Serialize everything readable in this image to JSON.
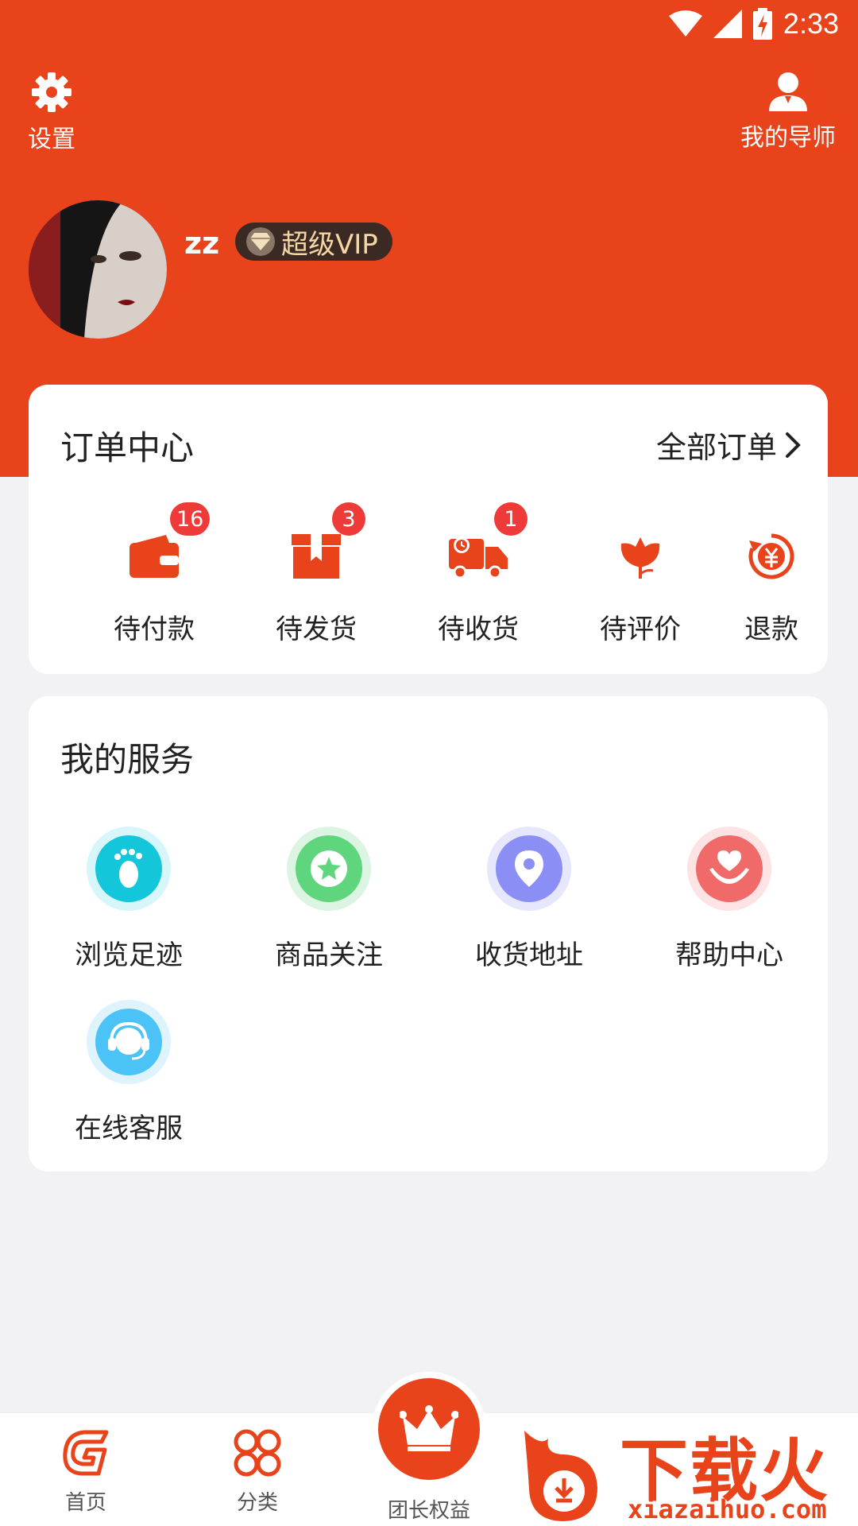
{
  "status_bar": {
    "time": "2:33"
  },
  "header": {
    "settings_label": "设置",
    "mentor_label": "我的导师"
  },
  "profile": {
    "username": "zz",
    "vip_label": "超级VIP"
  },
  "orders": {
    "title": "订单中心",
    "all_orders_label": "全部订单",
    "items": [
      {
        "label": "待付款",
        "badge": "16",
        "icon": "wallet-icon"
      },
      {
        "label": "待发货",
        "badge": "3",
        "icon": "box-icon"
      },
      {
        "label": "待收货",
        "badge": "1",
        "icon": "truck-icon"
      },
      {
        "label": "待评价",
        "badge": "",
        "icon": "flower-icon"
      },
      {
        "label": "退款",
        "badge": "",
        "icon": "refund-icon"
      }
    ]
  },
  "services": {
    "title": "我的服务",
    "items": [
      {
        "label": "浏览足迹",
        "icon": "footprint-icon",
        "color": "#14c6da"
      },
      {
        "label": "商品关注",
        "icon": "star-icon",
        "color": "#5fd57e"
      },
      {
        "label": "收货地址",
        "icon": "location-pin-icon",
        "color": "#8b8ef5"
      },
      {
        "label": "帮助中心",
        "icon": "helping-hand-heart-icon",
        "color": "#f06a6a"
      },
      {
        "label": "在线客服",
        "icon": "headset-icon",
        "color": "#4cc3f7"
      }
    ]
  },
  "tabbar": {
    "items": [
      {
        "label": "首页",
        "icon": "home-logo-icon"
      },
      {
        "label": "分类",
        "icon": "category-grid-icon"
      },
      {
        "label": "团长权益",
        "icon": "crown-icon"
      }
    ]
  },
  "watermark": {
    "text": "下载火",
    "url": "xiazaihuo.com"
  },
  "colors": {
    "brand": "#e8431a",
    "badge": "#ee3b39",
    "vip_bg": "#3b2a24",
    "vip_text": "#f5d7a5"
  }
}
